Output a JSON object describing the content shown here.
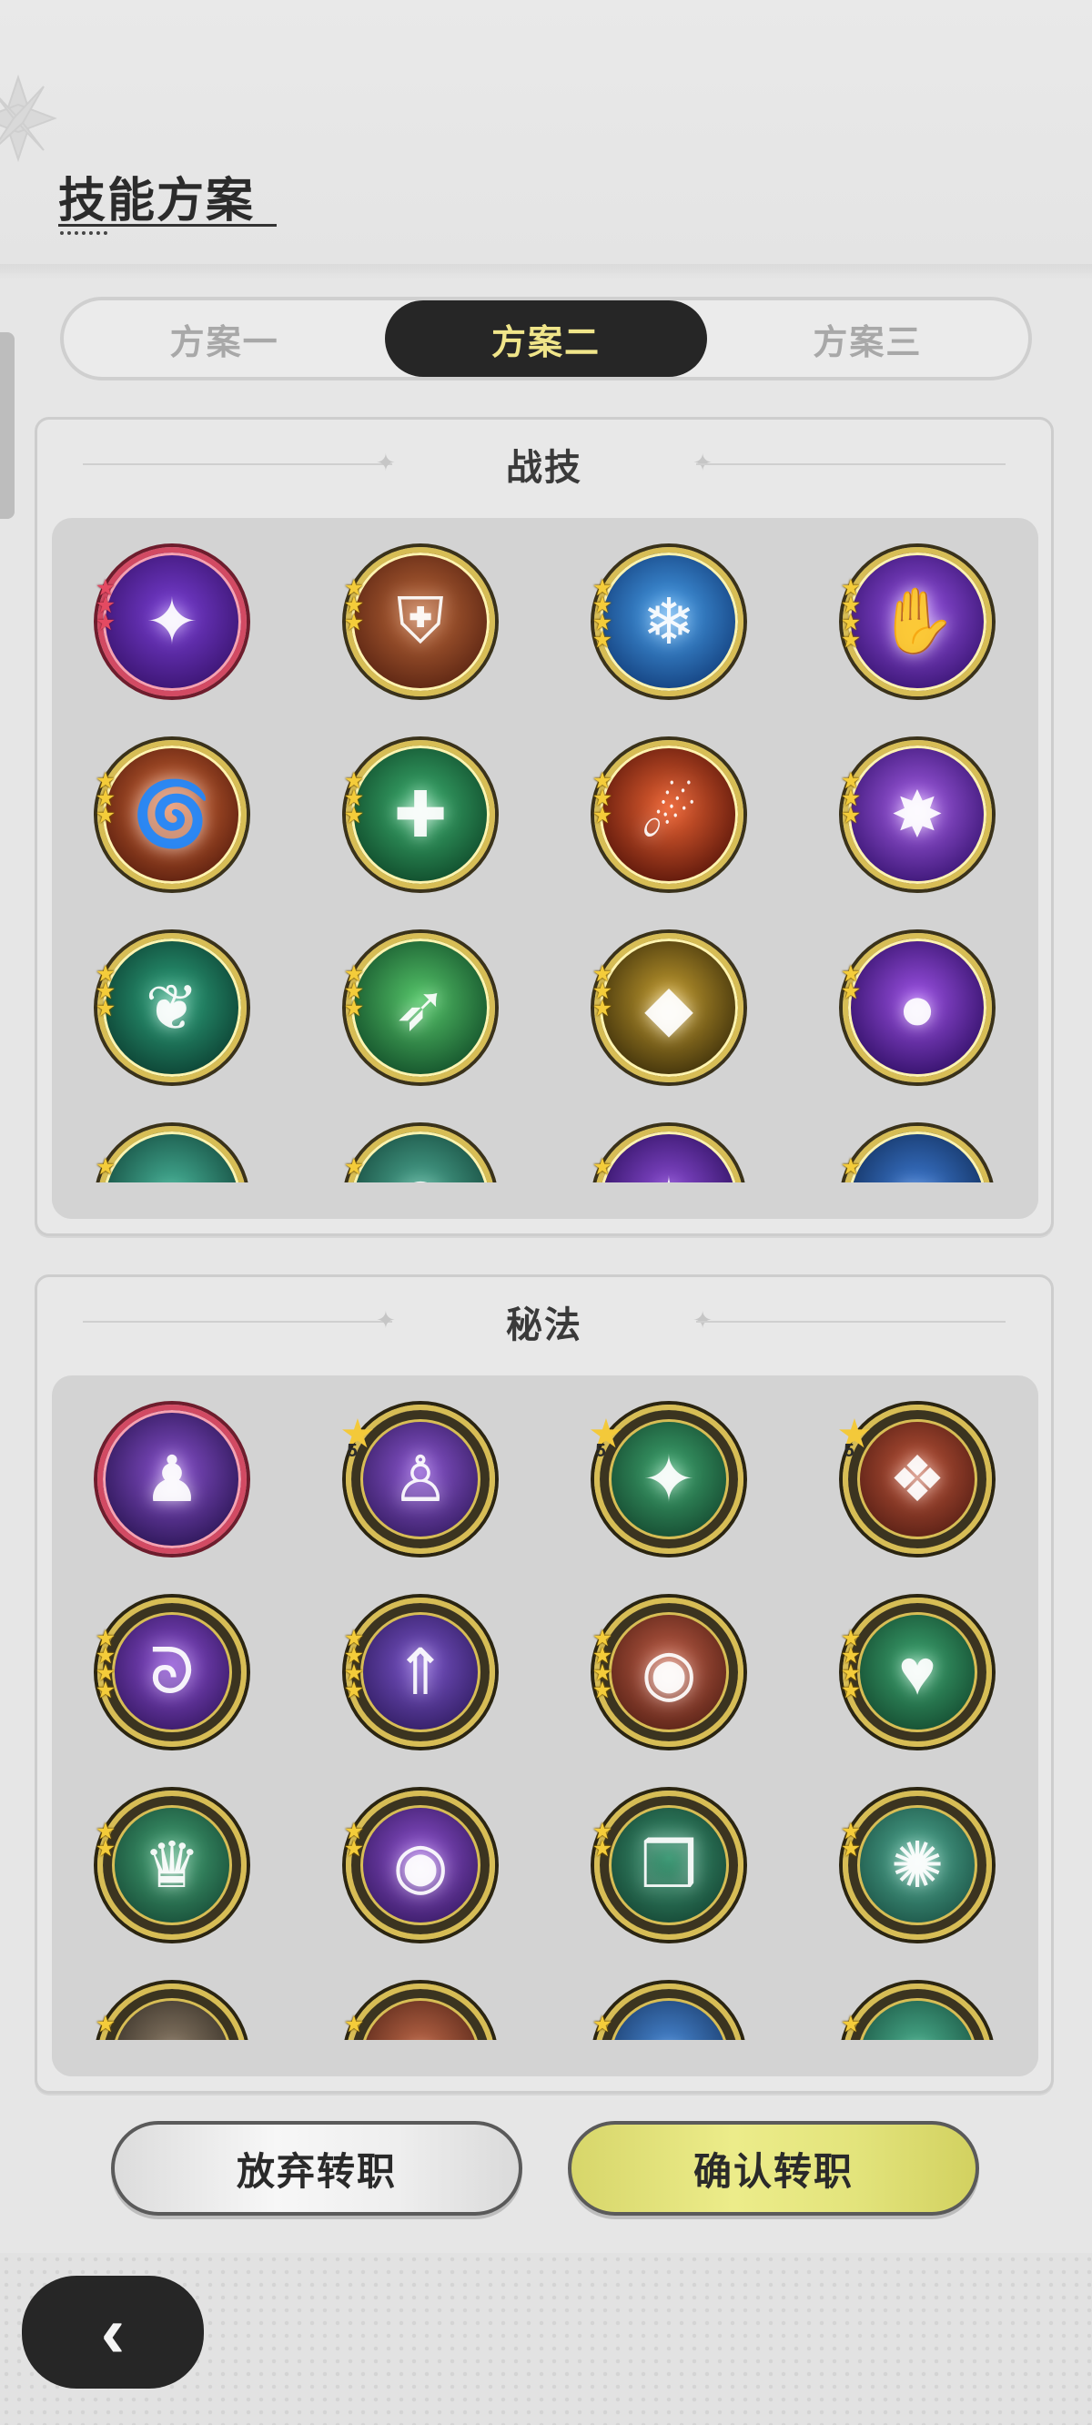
{
  "page": {
    "title": "技能方案"
  },
  "tabs": [
    {
      "label": "方案一",
      "active": false
    },
    {
      "label": "方案二",
      "active": true
    },
    {
      "label": "方案三",
      "active": false
    }
  ],
  "combat_section": {
    "title": "战技",
    "rows": [
      [
        {
          "icon": "violet-star-burst-icon",
          "stars": 3,
          "star_color": "red",
          "rim": "red",
          "tint": [
            "#7a3fd6",
            "#3a1470"
          ]
        },
        {
          "icon": "bronze-shield-crest-icon",
          "stars": 3,
          "rim": "gold",
          "tint": [
            "#c06a3a",
            "#5a2412"
          ]
        },
        {
          "icon": "frost-shield-icon",
          "stars": 4,
          "rim": "gold",
          "tint": [
            "#4aa3ee",
            "#13407e"
          ]
        },
        {
          "icon": "arcane-hand-icon",
          "stars": 4,
          "rim": "gold",
          "tint": [
            "#9a54e8",
            "#3a1574"
          ]
        }
      ],
      [
        {
          "icon": "fire-swirl-icon",
          "stars": 3,
          "rim": "gold",
          "tint": [
            "#e0703a",
            "#5a1e0e"
          ]
        },
        {
          "icon": "green-plus-heal-icon",
          "stars": 3,
          "rim": "gold",
          "tint": [
            "#3fb573",
            "#0f4a2a"
          ]
        },
        {
          "icon": "fireball-icon",
          "stars": 3,
          "rim": "gold",
          "tint": [
            "#ee6433",
            "#5a160a"
          ]
        },
        {
          "icon": "violet-shatter-icon",
          "stars": 3,
          "rim": "gold",
          "tint": [
            "#a860ea",
            "#3a1574"
          ]
        }
      ],
      [
        {
          "icon": "thorn-vine-icon",
          "stars": 3,
          "rim": "gold",
          "tint": [
            "#2fa880",
            "#0c4032"
          ]
        },
        {
          "icon": "wind-slash-icon",
          "stars": 3,
          "rim": "gold",
          "tint": [
            "#56c76a",
            "#13502a"
          ]
        },
        {
          "icon": "golden-crystal-icon",
          "stars": 3,
          "rim": "gold",
          "tint": [
            "#c8a030",
            "#3e300a"
          ]
        },
        {
          "icon": "violet-orb-icon",
          "stars": 2,
          "rim": "gold",
          "tint": [
            "#9e52e6",
            "#321068"
          ]
        }
      ],
      [
        {
          "icon": "teal-wave-icon",
          "stars": 1,
          "rim": "gold",
          "tint": [
            "#48b59a",
            "#144a3e"
          ]
        },
        {
          "icon": "teal-swirl-icon",
          "stars": 1,
          "rim": "gold",
          "tint": [
            "#4fae96",
            "#164a3e"
          ]
        },
        {
          "icon": "violet-constellation-icon",
          "stars": 1,
          "rim": "gold",
          "tint": [
            "#8e4ed8",
            "#2e1060"
          ]
        },
        {
          "icon": "blue-wave-icon",
          "stars": 1,
          "rim": "gold",
          "tint": [
            "#3e7cd6",
            "#12305e"
          ]
        }
      ]
    ]
  },
  "arcana_section": {
    "title": "秘法",
    "rows": [
      [
        {
          "icon": "hooded-mage-icon",
          "stars": 0,
          "rim": "red",
          "tint": [
            "#8a52d0",
            "#2c1656"
          ]
        },
        {
          "icon": "spirit-figure-icon",
          "badge": "5",
          "rim": "dark",
          "tint": [
            "#8e58d4",
            "#2c1656"
          ]
        },
        {
          "icon": "green-spark-icon",
          "badge": "5",
          "rim": "dark",
          "tint": [
            "#3fa870",
            "#103e28"
          ]
        },
        {
          "icon": "red-crystal-cluster-icon",
          "badge": "5",
          "rim": "dark",
          "tint": [
            "#c0563a",
            "#4a1810"
          ]
        }
      ],
      [
        {
          "icon": "violet-swirl-icon",
          "stars": 4,
          "rim": "dark",
          "tint": [
            "#8e50d6",
            "#2c1256"
          ]
        },
        {
          "icon": "rising-figure-icon",
          "stars": 4,
          "rim": "dark",
          "tint": [
            "#7c56cc",
            "#281656"
          ]
        },
        {
          "icon": "red-vortex-icon",
          "stars": 4,
          "rim": "dark",
          "tint": [
            "#c46048",
            "#4a1a10"
          ]
        },
        {
          "icon": "green-heart-icon",
          "stars": 4,
          "rim": "dark",
          "tint": [
            "#3ea872",
            "#0f4028"
          ]
        }
      ],
      [
        {
          "icon": "green-crown-icon",
          "stars": 2,
          "rim": "dark",
          "tint": [
            "#46a878",
            "#124230"
          ]
        },
        {
          "icon": "violet-eye-hand-icon",
          "stars": 2,
          "rim": "dark",
          "tint": [
            "#9254d4",
            "#2e1458"
          ]
        },
        {
          "icon": "green-rock-icon",
          "stars": 2,
          "rim": "dark",
          "tint": [
            "#3e9a76",
            "#103c2c"
          ]
        },
        {
          "icon": "teal-orb-icon",
          "stars": 2,
          "rim": "dark",
          "tint": [
            "#52b096",
            "#164a3e"
          ]
        }
      ],
      [
        {
          "icon": "stone-arch-icon",
          "stars": 1,
          "rim": "dark",
          "tint": [
            "#8a7a66",
            "#2e2820"
          ]
        },
        {
          "icon": "red-dome-icon",
          "stars": 1,
          "rim": "dark",
          "tint": [
            "#c06a4a",
            "#4a1e12"
          ]
        },
        {
          "icon": "blue-dome-icon",
          "stars": 1,
          "rim": "dark",
          "tint": [
            "#4a8ad6",
            "#14325e"
          ]
        },
        {
          "icon": "teal-dome-icon",
          "stars": 1,
          "rim": "dark",
          "tint": [
            "#4cb08e",
            "#144a3a"
          ]
        }
      ]
    ]
  },
  "buttons": {
    "cancel": "放弃转职",
    "confirm": "确认转职"
  },
  "nav": {
    "back_icon": "chevron-left-icon"
  }
}
